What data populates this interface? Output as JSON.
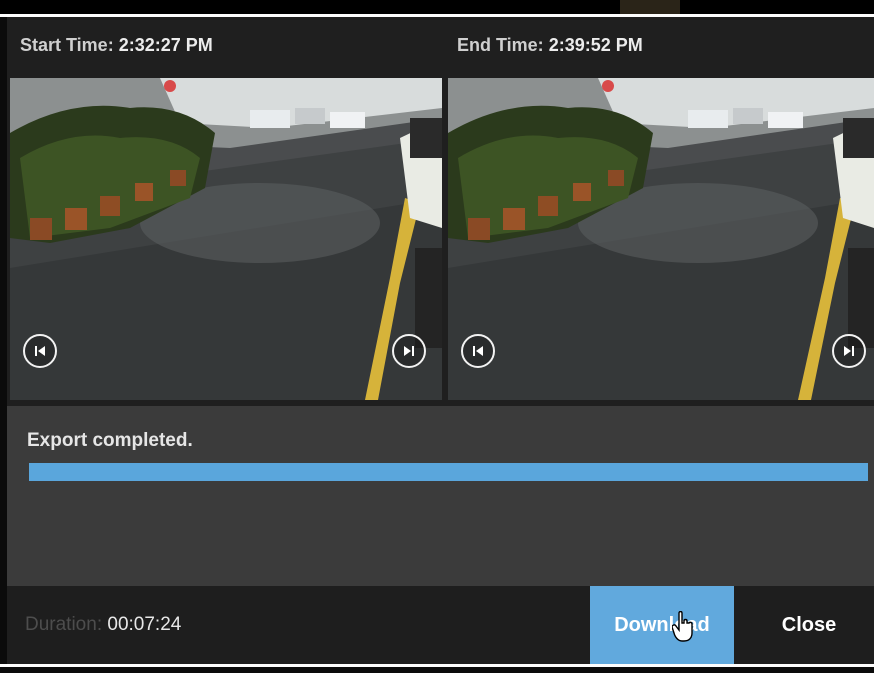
{
  "header": {
    "start_label": "Start Time:",
    "start_value": "2:32:27 PM",
    "end_label": "End Time:",
    "end_value": "2:39:52 PM"
  },
  "previews": {
    "start": {
      "prev_icon": "skip-back-icon",
      "next_icon": "skip-forward-icon"
    },
    "end": {
      "prev_icon": "skip-back-icon",
      "next_icon": "skip-forward-icon"
    }
  },
  "export": {
    "status": "Export completed.",
    "progress": 1.0,
    "progress_color": "#5aa6dc"
  },
  "footer": {
    "duration_label": "Duration:",
    "duration_value": "00:07:24",
    "download_label": "Download",
    "close_label": "Close",
    "accent_color": "#61a9dd"
  }
}
